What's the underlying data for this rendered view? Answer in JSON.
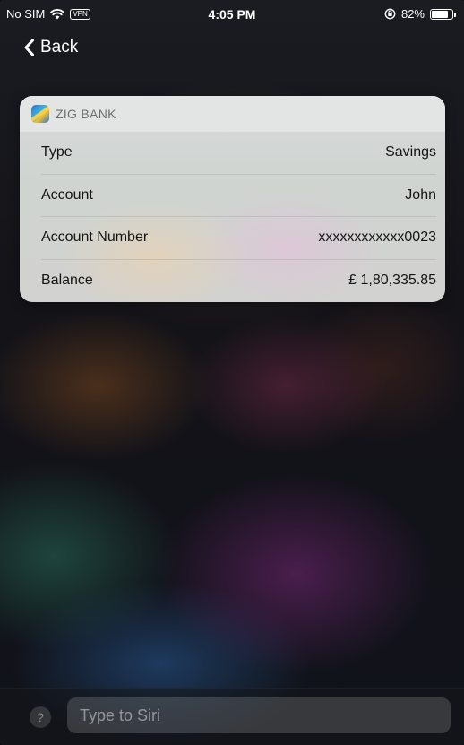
{
  "status_bar": {
    "carrier": "No SIM",
    "vpn": "VPN",
    "time": "4:05 PM",
    "battery_percent": "82%",
    "battery_level": 0.82,
    "icons": [
      "wifi-icon",
      "rotation-lock-icon",
      "battery-icon"
    ]
  },
  "nav": {
    "back_label": "Back",
    "back_icon": "chevron-left-icon"
  },
  "card": {
    "app_name": "ZIG BANK",
    "app_icon": "zig-bank-app-icon",
    "rows": [
      {
        "label": "Type",
        "value": "Savings"
      },
      {
        "label": "Account",
        "value": "John"
      },
      {
        "label": "Account Number",
        "value": "xxxxxxxxxxxx0023"
      },
      {
        "label": "Balance",
        "value": "£ 1,80,335.85"
      }
    ]
  },
  "siri": {
    "help_icon": "question-mark-icon",
    "help_glyph": "?",
    "placeholder": "Type to Siri"
  }
}
